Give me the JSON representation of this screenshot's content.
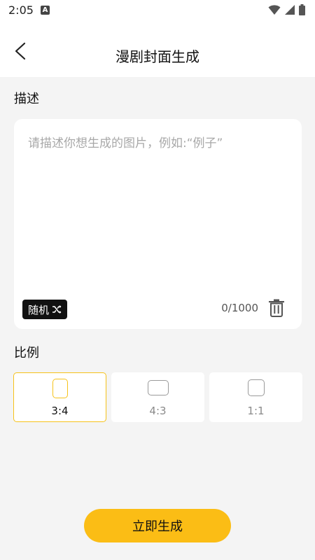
{
  "status_bar": {
    "time": "2:05",
    "notification_icon": "a-app-icon",
    "icons": [
      "wifi-icon",
      "signal-icon",
      "battery-icon"
    ]
  },
  "header": {
    "title": "漫剧封面生成",
    "back_icon": "chevron-left-icon"
  },
  "description": {
    "label": "描述",
    "placeholder": "请描述你想生成的图片，例如:“例子”",
    "value": "",
    "random_button": "随机",
    "random_icon": "shuffle-icon",
    "counter": "0/1000",
    "delete_icon": "trash-icon"
  },
  "ratio": {
    "label": "比例",
    "options": [
      {
        "label": "3:4",
        "selected": true
      },
      {
        "label": "4:3",
        "selected": false
      },
      {
        "label": "1:1",
        "selected": false
      }
    ]
  },
  "generate_button": "立即生成",
  "colors": {
    "accent": "#fbbd15",
    "selected_border": "#f6c21a",
    "background": "#f4f4f4"
  }
}
